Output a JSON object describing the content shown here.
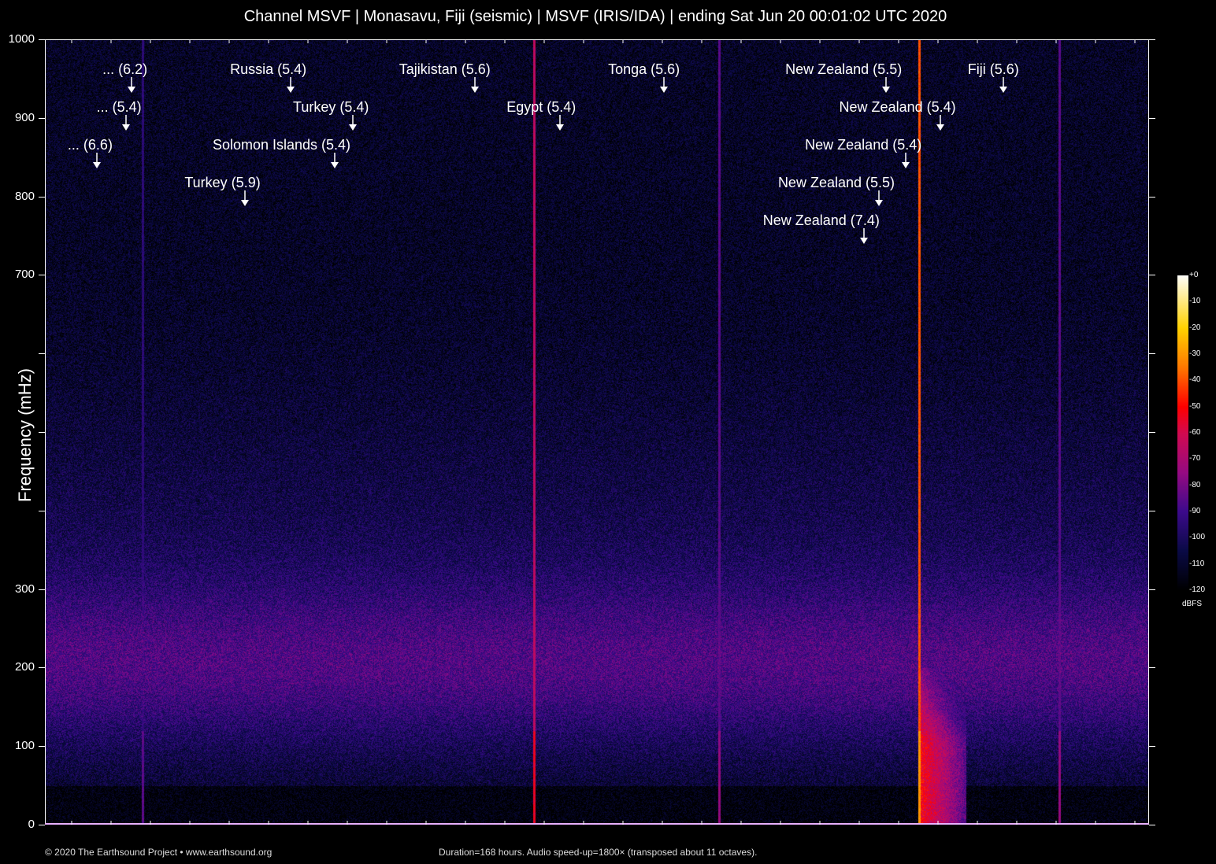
{
  "title": "Channel MSVF | Monasavu, Fiji (seismic) | MSVF (IRIS/IDA) | ending Sat Jun 20 00:01:02 UTC 2020",
  "chart_data": {
    "type": "heatmap",
    "title": "Channel MSVF | Monasavu, Fiji (seismic) | MSVF (IRIS/IDA) | ending Sat Jun 20 00:01:02 UTC 2020",
    "xlabel": "",
    "ylabel": "Frequency (mHz)",
    "xlim_hours": [
      0,
      168
    ],
    "ylim": [
      0,
      1000
    ],
    "y_ticks": [
      0,
      100,
      200,
      300,
      400,
      500,
      600,
      700,
      800,
      900,
      1000
    ],
    "y_tick_labels": [
      "0",
      "100",
      "200",
      "300",
      "",
      "",
      "",
      "700",
      "800",
      "900",
      "1000"
    ],
    "colorbar": {
      "label": "dBFS",
      "range": [
        -120,
        0
      ],
      "tick_labels": [
        "+0",
        "-10",
        "-20",
        "-30",
        "-40",
        "-50",
        "-60",
        "-70",
        "-80",
        "-90",
        "-100",
        "-110",
        "-120"
      ]
    },
    "events": [
      {
        "label": "... (6.2)",
        "hour": 13.2,
        "row": 0
      },
      {
        "label": "... (5.4)",
        "hour": 12.3,
        "row": 1
      },
      {
        "label": "... (6.6)",
        "hour": 7.9,
        "row": 2
      },
      {
        "label": "Russia (5.4)",
        "hour": 37.4,
        "row": 0
      },
      {
        "label": "Turkey (5.4)",
        "hour": 46.9,
        "row": 1
      },
      {
        "label": "Solomon Islands (5.4)",
        "hour": 44.1,
        "row": 2
      },
      {
        "label": "Turkey (5.9)",
        "hour": 30.4,
        "row": 3
      },
      {
        "label": "Tajikistan (5.6)",
        "hour": 65.4,
        "row": 0
      },
      {
        "label": "Egypt (5.4)",
        "hour": 78.4,
        "row": 1
      },
      {
        "label": "Tonga (5.6)",
        "hour": 94.2,
        "row": 0
      },
      {
        "label": "New Zealand (5.5)",
        "hour": 128.0,
        "row": 0
      },
      {
        "label": "Fiji (5.6)",
        "hour": 145.8,
        "row": 0
      },
      {
        "label": "New Zealand (5.4)",
        "hour": 136.2,
        "row": 1
      },
      {
        "label": "New Zealand (5.4)",
        "hour": 131.0,
        "row": 2
      },
      {
        "label": "New Zealand (5.5)",
        "hour": 126.9,
        "row": 3
      },
      {
        "label": "New Zealand (7.4)",
        "hour": 124.6,
        "row": 4
      }
    ],
    "signal_lines": [
      {
        "hour": 14.8,
        "level": -95
      },
      {
        "hour": 74.4,
        "level": -65
      },
      {
        "hour": 102.6,
        "level": -85
      },
      {
        "hour": 133.0,
        "level": -40
      },
      {
        "hour": 154.3,
        "level": -85
      }
    ]
  },
  "footer": {
    "copyright": "© 2020 The Earthsound Project • www.earthsound.org",
    "info": "Duration=168 hours. Audio speed-up=1800× (transposed about 11 octaves)."
  }
}
